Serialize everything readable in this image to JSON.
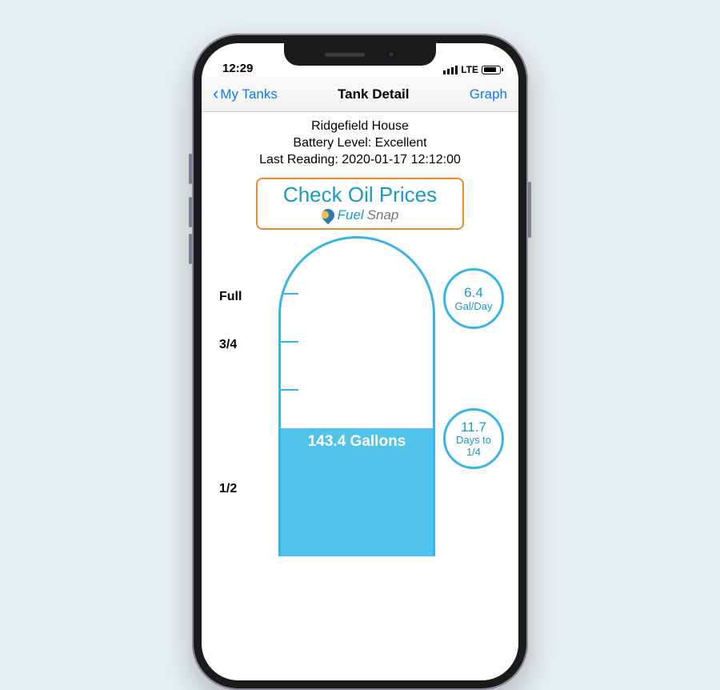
{
  "status": {
    "time": "12:29",
    "carrier": "LTE"
  },
  "nav": {
    "back": "My Tanks",
    "title": "Tank Detail",
    "action": "Graph"
  },
  "info": {
    "name": "Ridgefield House",
    "battery_label": "Battery Level: Excellent",
    "last_reading": "Last Reading: 2020-01-17 12:12:00"
  },
  "promo": {
    "headline": "Check Oil Prices",
    "brand1": "Fuel",
    "brand2": "Snap"
  },
  "gauge": {
    "marks": [
      "Full",
      "3/4",
      "1/2"
    ],
    "reading": "143.4 Gallons"
  },
  "stats": {
    "rate_value": "6.4",
    "rate_unit": "Gal/Day",
    "days_value": "11.7",
    "days_label1": "Days to",
    "days_label2": "1/4"
  },
  "chart_data": {
    "type": "table",
    "title": "Tank Detail — Ridgefield House",
    "fields": {
      "last_reading_timestamp": "2020-01-17 12:12:00",
      "battery_level": "Excellent",
      "current_gallons": 143.4,
      "fill_fraction_approx": 0.5,
      "consumption_gal_per_day": 6.4,
      "days_to_one_quarter": 11.7,
      "gauge_marks_visible": [
        "Full",
        "3/4",
        "1/2"
      ]
    }
  }
}
